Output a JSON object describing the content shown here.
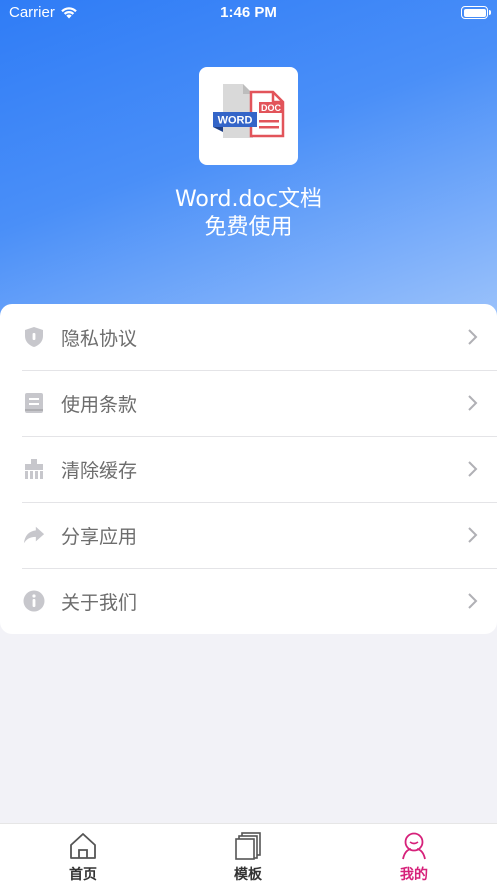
{
  "status_bar": {
    "carrier": "Carrier",
    "time": "1:46 PM"
  },
  "app": {
    "title_line1": "Word.doc文档",
    "title_line2": "免费使用",
    "icon_badge_doc": "DOC",
    "icon_badge_word": "WORD"
  },
  "menu": {
    "items": [
      {
        "label": "隐私协议",
        "icon": "shield-icon"
      },
      {
        "label": "使用条款",
        "icon": "document-icon"
      },
      {
        "label": "清除缓存",
        "icon": "broom-icon"
      },
      {
        "label": "分享应用",
        "icon": "share-arrow-icon"
      },
      {
        "label": "关于我们",
        "icon": "info-icon"
      }
    ]
  },
  "tabbar": {
    "tabs": [
      {
        "label": "首页",
        "icon": "home-icon",
        "active": false
      },
      {
        "label": "模板",
        "icon": "templates-icon",
        "active": false
      },
      {
        "label": "我的",
        "icon": "profile-icon",
        "active": true
      }
    ]
  },
  "colors": {
    "gradient_start": "#2f7cf6",
    "gradient_end": "#9ec4fb",
    "active_tab": "#d6217a",
    "menu_text": "#6d6d6d"
  }
}
